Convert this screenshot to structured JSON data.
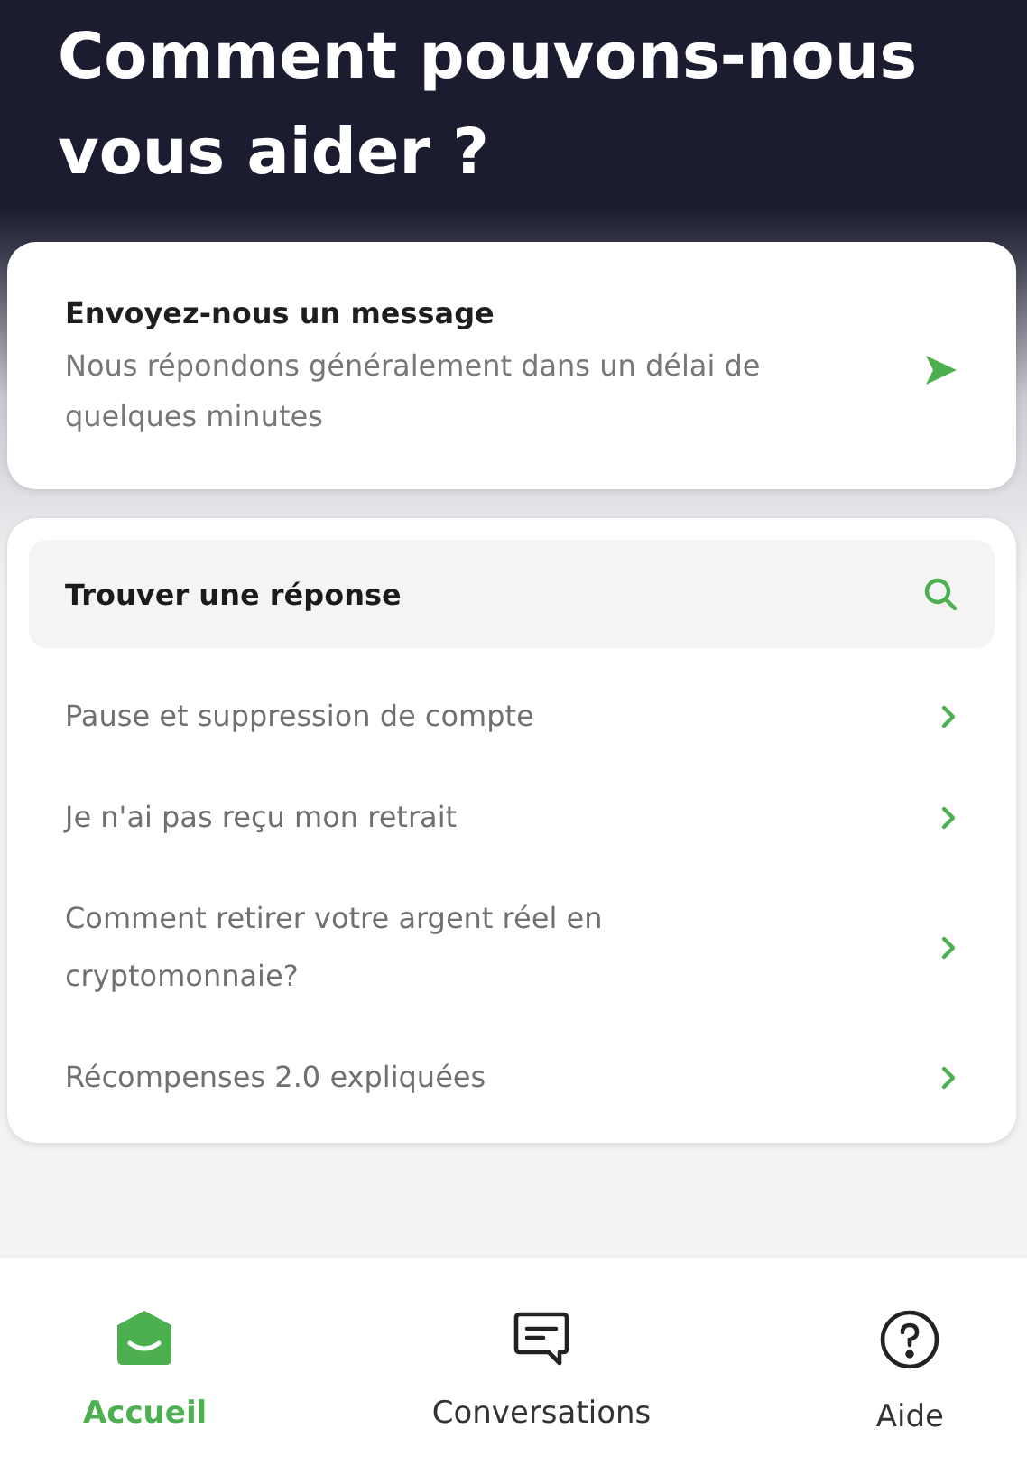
{
  "header": {
    "title": "Comment pouvons-nous vous aider ?"
  },
  "message_card": {
    "title": "Envoyez-nous un message",
    "subtitle": "Nous répondons généralement dans un délai de quelques minutes"
  },
  "help_card": {
    "search": {
      "label": "Trouver une réponse"
    },
    "articles": [
      {
        "title": "Pause et suppression de compte"
      },
      {
        "title": "Je n'ai pas reçu mon retrait"
      },
      {
        "title": "Comment retirer votre argent réel en cryptomonnaie?"
      },
      {
        "title": "Récompenses 2.0 expliquées"
      }
    ]
  },
  "bottom_nav": [
    {
      "label": "Accueil",
      "selected": true
    },
    {
      "label": "Conversations",
      "selected": false
    },
    {
      "label": "Aide",
      "selected": false
    }
  ]
}
